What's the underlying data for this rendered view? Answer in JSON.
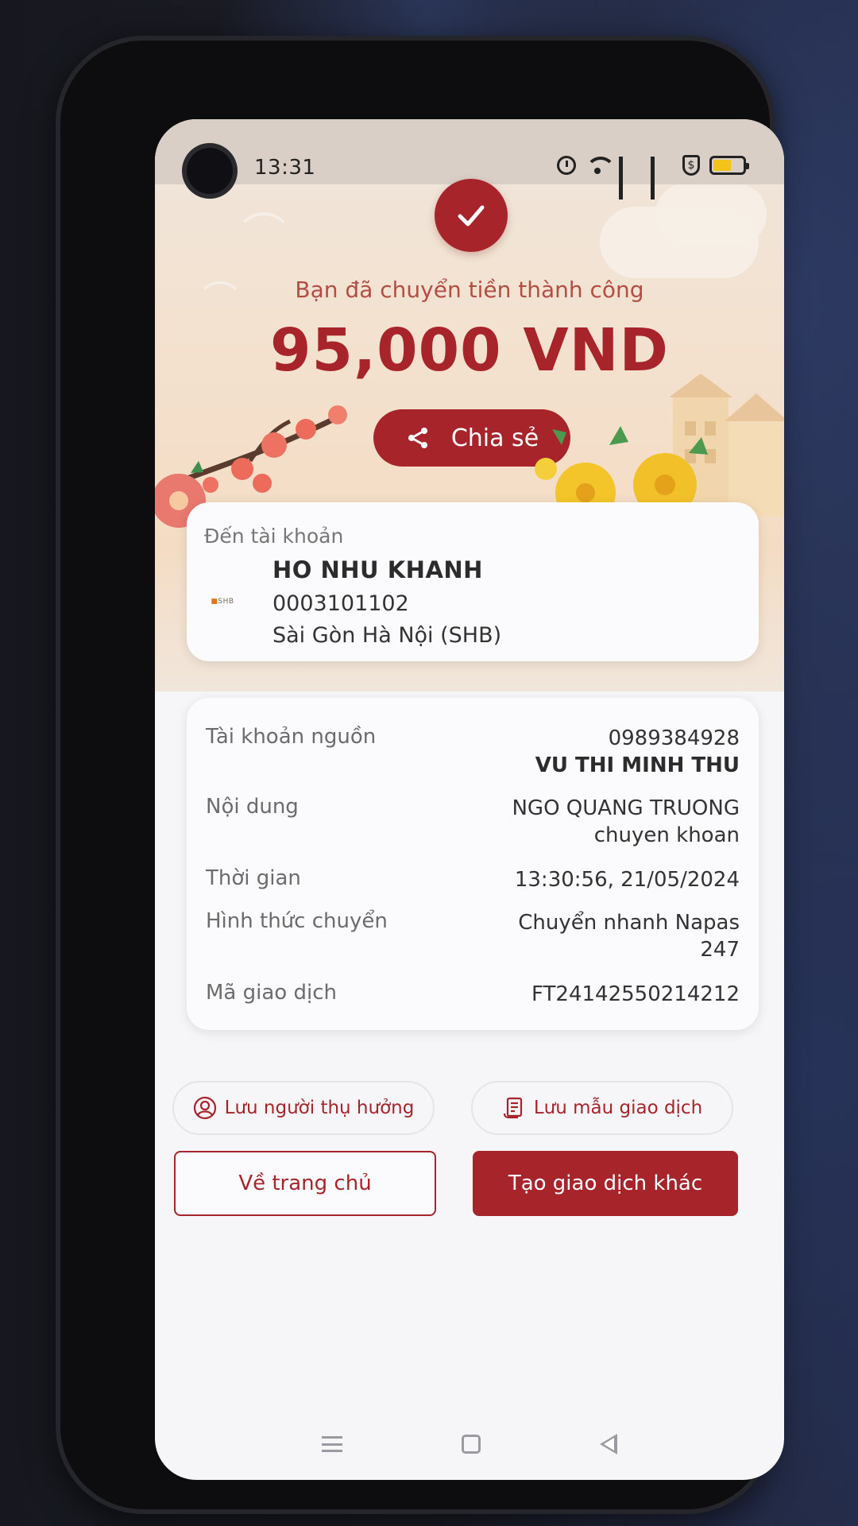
{
  "status_bar": {
    "time": "13:31",
    "icons": [
      "alarm-icon",
      "wifi-icon",
      "signal-icon",
      "signal-icon",
      "shield-dollar-icon",
      "battery-icon"
    ],
    "battery_color": "#f2c318"
  },
  "header": {
    "success_message": "Bạn đã chuyển tiền thành công",
    "amount": "95,000 VND",
    "share_label": "Chia sẻ",
    "accent_color": "#a8242b"
  },
  "recipient": {
    "label": "Đến tài khoản",
    "bank_logo_text": "SHB",
    "name": "HO NHU KHANH",
    "account_number": "0003101102",
    "bank_name": "Sài Gòn Hà Nội (SHB)"
  },
  "details": {
    "source_account": {
      "label": "Tài khoản nguồn",
      "number": "0989384928",
      "owner": "VU THI MINH THU"
    },
    "content": {
      "label": "Nội dung",
      "line1": "NGO QUANG TRUONG",
      "line2": "chuyen khoan"
    },
    "time": {
      "label": "Thời gian",
      "value": "13:30:56, 21/05/2024"
    },
    "method": {
      "label": "Hình thức chuyển",
      "line1": "Chuyển nhanh Napas",
      "line2": "247"
    },
    "transaction_id": {
      "label": "Mã giao dịch",
      "value": "FT24142550214212"
    }
  },
  "actions": {
    "save_payee_label": "Lưu người thụ hưởng",
    "save_template_label": "Lưu mẫu giao dịch",
    "home_label": "Về trang chủ",
    "new_transaction_label": "Tạo giao dịch khác"
  }
}
